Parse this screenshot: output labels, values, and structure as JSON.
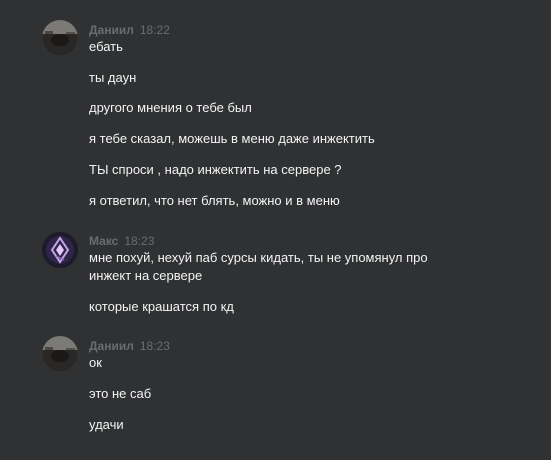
{
  "conversation": {
    "groups": [
      {
        "author": "Даниил",
        "time": "18:22",
        "avatar_icon": "dark-photo-avatar",
        "messages": [
          "ебать",
          "ты даун",
          "другого мнения о тебе был",
          "я тебе сказал, можешь в меню даже инжектить",
          "ТЫ спроси , надо инжектить на сервере ?",
          "я ответил, что нет блять, можно и в меню"
        ]
      },
      {
        "author": "Макс",
        "time": "18:23",
        "avatar_icon": "purple-emblem-avatar",
        "messages": [
          "мне похуй, нехуй паб сурсы кидать, ты не упомянул про инжект на сервере",
          "которые крашатся по кд"
        ]
      },
      {
        "author": "Даниил",
        "time": "18:23",
        "avatar_icon": "dark-photo-avatar",
        "messages": [
          "ок",
          "это не саб",
          "удачи"
        ]
      }
    ]
  }
}
